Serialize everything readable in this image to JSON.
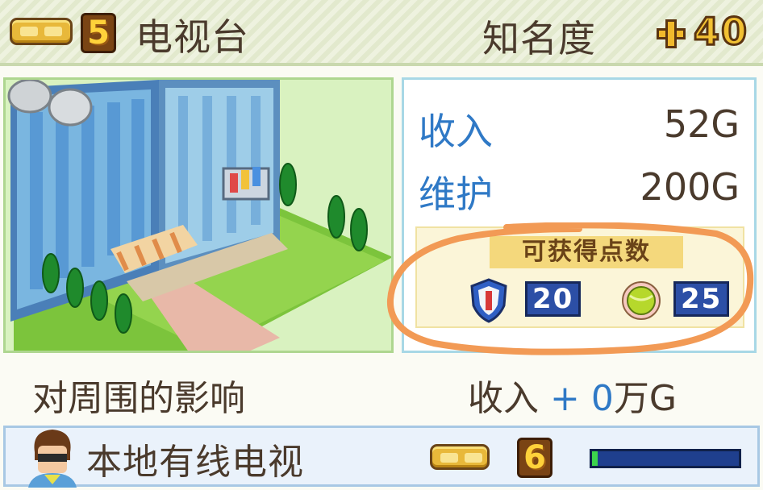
{
  "header": {
    "level_value": "5",
    "facility_name": "电视台",
    "fame_label": "知名度",
    "fame_value": "40"
  },
  "stats": {
    "income_label": "收入",
    "income_value": "52G",
    "upkeep_label": "维护",
    "upkeep_value": "200G",
    "points_title": "可获得点数",
    "points": [
      {
        "icon": "shield-icon",
        "value": "20"
      },
      {
        "icon": "tennis-ball-icon",
        "value": "25"
      }
    ]
  },
  "effect": {
    "label": "对周围的影响",
    "income_label": "收入",
    "income_sign": "+",
    "income_value": "0",
    "income_unit": "万G"
  },
  "neighbor": {
    "name": "本地有线电视",
    "level_value": "6",
    "progress": 0.04
  },
  "colors": {
    "accent_blue": "#2f79c6",
    "annotation_orange": "#f29a55",
    "progress_fill": "#3cd44c"
  }
}
